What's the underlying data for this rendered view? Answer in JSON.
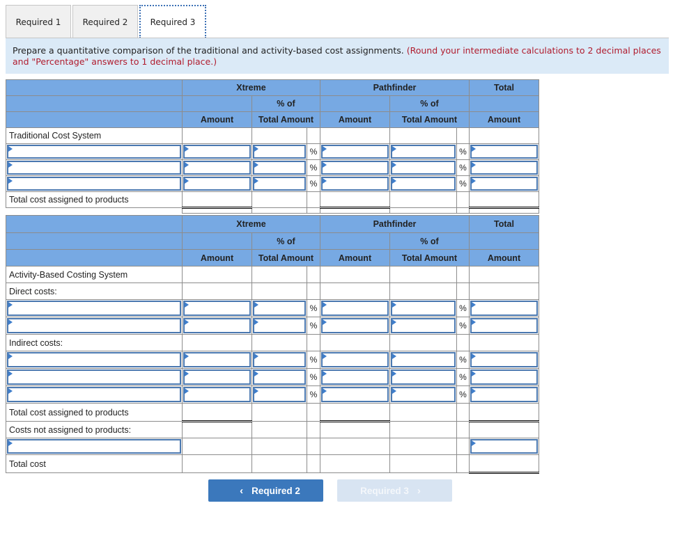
{
  "tabs": [
    {
      "label": "Required 1",
      "active": false
    },
    {
      "label": "Required 2",
      "active": false
    },
    {
      "label": "Required 3",
      "active": true
    }
  ],
  "instructions": {
    "text": "Prepare a quantitative comparison of the traditional and activity-based cost assignments.",
    "note": "(Round your intermediate calculations to 2 decimal places and \"Percentage\" answers to 1 decimal place.)"
  },
  "table_headers": {
    "xtreme": "Xtreme",
    "pathfinder": "Pathfinder",
    "total": "Total",
    "pct_of": "% of",
    "amount": "Amount",
    "total_amount": "Total Amount"
  },
  "traditional": {
    "title": "Traditional Cost System",
    "total_label": "Total cost assigned to products",
    "pct_symbol": "%"
  },
  "abc": {
    "title": "Activity-Based Costing System",
    "direct_label": "Direct costs:",
    "indirect_label": "Indirect costs:",
    "total_assigned_label": "Total cost assigned to products",
    "not_assigned_label": "Costs not assigned to products:",
    "total_cost_label": "Total cost",
    "pct_symbol": "%"
  },
  "nav": {
    "prev_label": "Required 2",
    "next_label": "Required 3",
    "prev_icon": "‹",
    "next_icon": "›"
  }
}
